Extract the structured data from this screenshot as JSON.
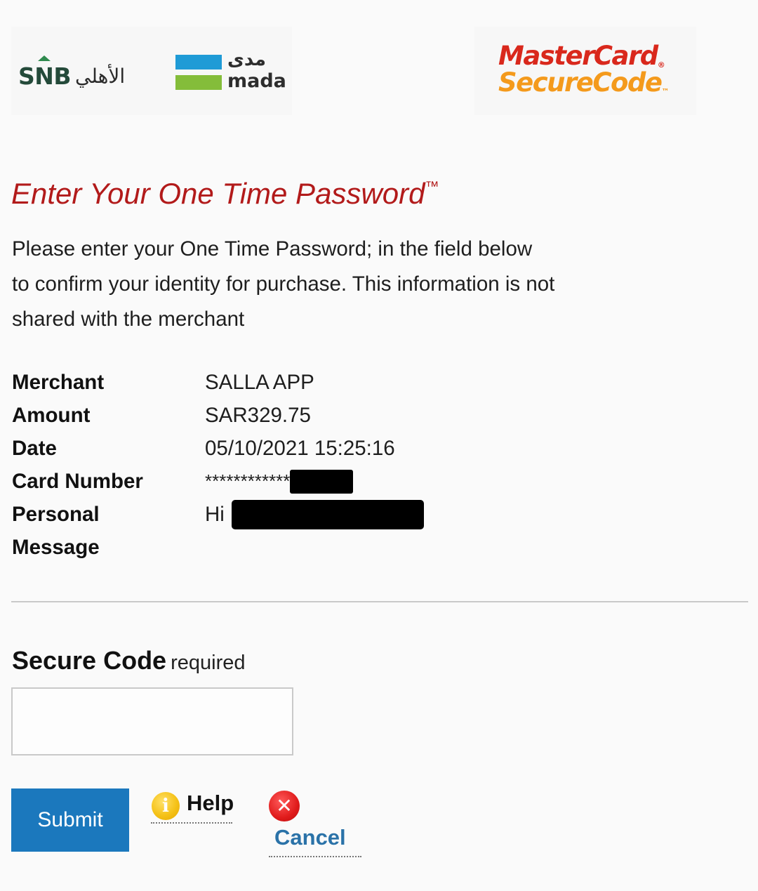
{
  "header": {
    "snb_logo_latin": "SNB",
    "snb_logo_arabic": "الأهلي",
    "mada_logo_arabic": "مدى",
    "mada_logo_latin": "mada",
    "mc_logo_line1": "MasterCard",
    "mc_logo_line2": "SecureCode",
    "mc_registered": "®",
    "mc_trademark": "™",
    "colors": {
      "snb_green": "#244a3a",
      "mada_blue": "#1f9bd6",
      "mada_green": "#84bd3a",
      "mc_red": "#d9281c",
      "mc_orange": "#f49a1c"
    }
  },
  "title": {
    "text": "Enter Your One Time Password",
    "trademark": "™",
    "color": "#b21a1a"
  },
  "intro": {
    "line1": "Please enter your One Time Password; in the field below",
    "line2": "to confirm your identity for purchase. This information is not",
    "line3": "shared with the merchant"
  },
  "details": {
    "merchant_label": "Merchant",
    "merchant_value": "SALLA APP",
    "amount_label": "Amount",
    "amount_value": "SAR329.75",
    "date_label": "Date",
    "date_value": "05/10/2021 15:25:16",
    "card_label": "Card Number",
    "card_value": "************",
    "message_label_1": "Personal",
    "message_label_2": "Message",
    "message_value": "Hi"
  },
  "form": {
    "code_label": "Secure Code",
    "code_required": "required",
    "code_value": "",
    "submit_label": "Submit",
    "help_label": "Help",
    "help_icon": "info-icon",
    "cancel_label": "Cancel",
    "cancel_icon": "close-icon",
    "submit_color": "#1b78bd",
    "cancel_color": "#2a72a8"
  }
}
